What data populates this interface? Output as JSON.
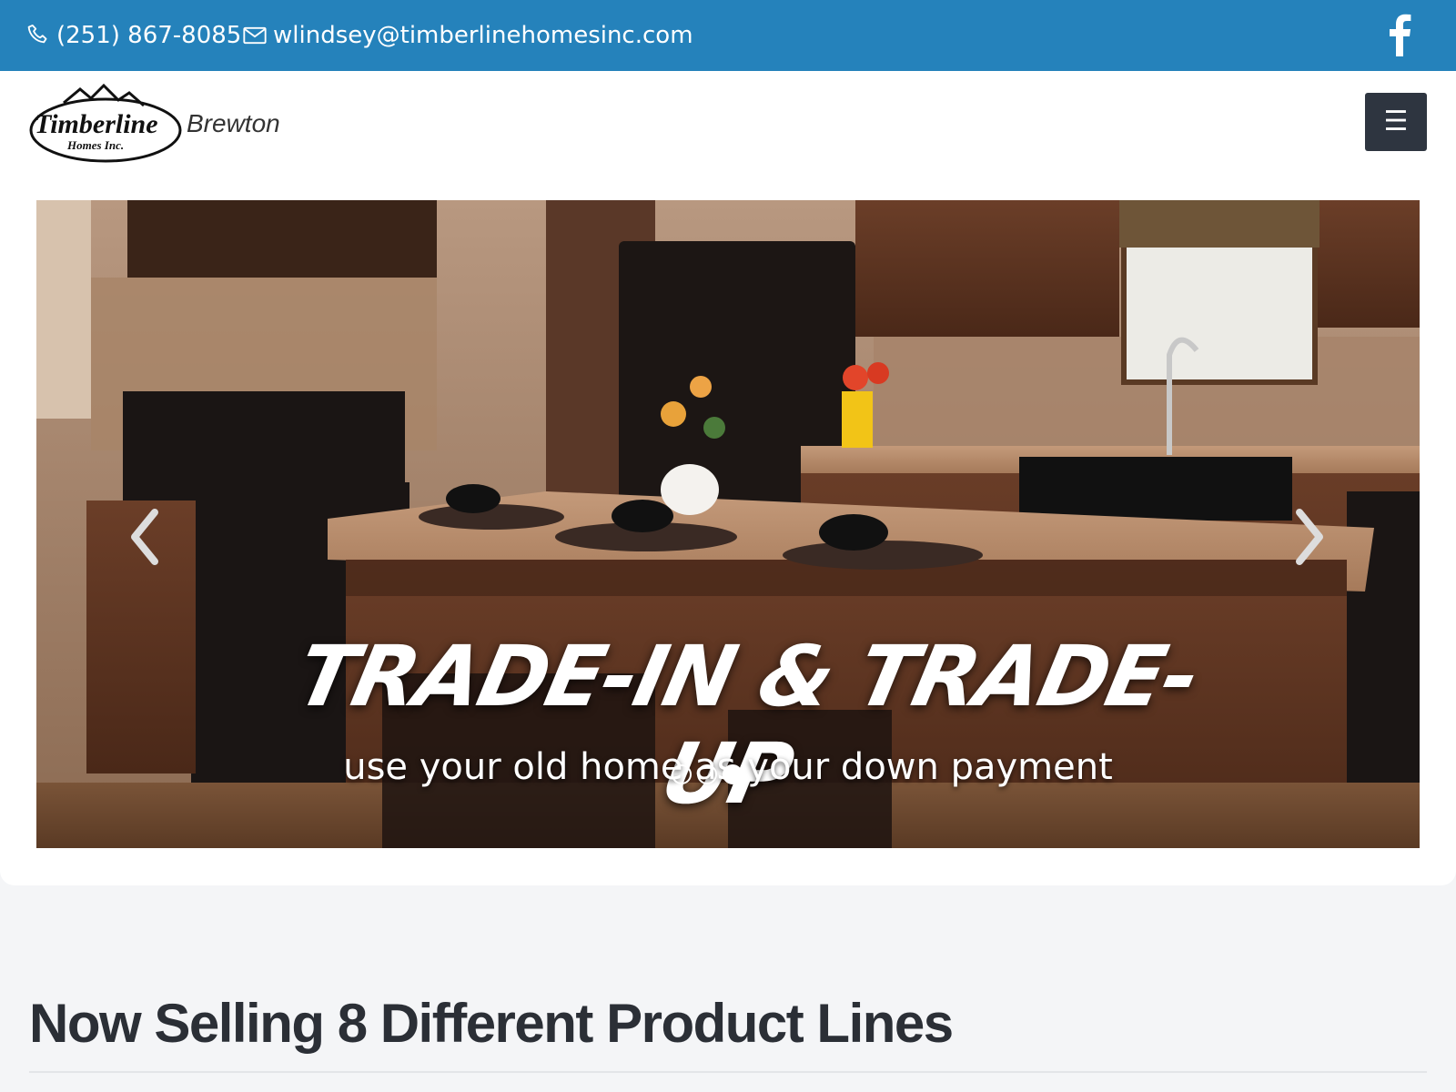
{
  "topbar": {
    "phone": "(251) 867-8085",
    "email": "wlindsey@timberlinehomesinc.com",
    "social_icon": "facebook-icon",
    "bg_color": "#2582bb"
  },
  "header": {
    "logo_text": "Timberline",
    "logo_subtext": "Homes Inc.",
    "location": "Brewton",
    "menu_icon": "hamburger-icon"
  },
  "hero": {
    "headline": "TRADE-IN & TRADE-UP",
    "subline": "use your old home as your down payment",
    "slides_count": 3,
    "active_slide": 3,
    "prev_icon": "chevron-left-icon",
    "next_icon": "chevron-right-icon"
  },
  "main": {
    "section_title": "Now Selling 8 Different Product Lines"
  }
}
